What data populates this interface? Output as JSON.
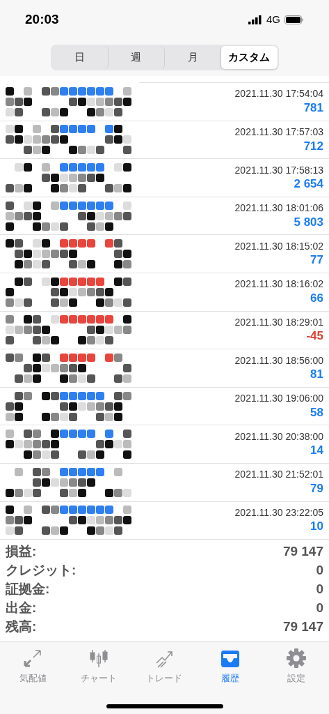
{
  "status_bar": {
    "time": "20:03",
    "network": "4G"
  },
  "segments": [
    {
      "label": "日",
      "selected": false
    },
    {
      "label": "週",
      "selected": false
    },
    {
      "label": "月",
      "selected": false
    },
    {
      "label": "カスタム",
      "selected": true
    }
  ],
  "trades": [
    {
      "time": "2021.11.30 17:54:04",
      "profit": "781",
      "loss": false,
      "color": "#2f7ff0"
    },
    {
      "time": "2021.11.30 17:57:03",
      "profit": "712",
      "loss": false,
      "color": "#2f7ff0"
    },
    {
      "time": "2021.11.30 17:58:13",
      "profit": "2 654",
      "loss": false,
      "color": "#2f7ff0"
    },
    {
      "time": "2021.11.30 18:01:06",
      "profit": "5 803",
      "loss": false,
      "color": "#2f7ff0"
    },
    {
      "time": "2021.11.30 18:15:02",
      "profit": "77",
      "loss": false,
      "color": "#e8453c"
    },
    {
      "time": "2021.11.30 18:16:02",
      "profit": "66",
      "loss": false,
      "color": "#e8453c"
    },
    {
      "time": "2021.11.30 18:29:01",
      "profit": "-45",
      "loss": true,
      "color": "#e8453c"
    },
    {
      "time": "2021.11.30 18:56:00",
      "profit": "81",
      "loss": false,
      "color": "#e8453c"
    },
    {
      "time": "2021.11.30 19:06:00",
      "profit": "58",
      "loss": false,
      "color": "#2f7ff0"
    },
    {
      "time": "2021.11.30 20:38:00",
      "profit": "14",
      "loss": false,
      "color": "#2f7ff0"
    },
    {
      "time": "2021.11.30 21:52:01",
      "profit": "79",
      "loss": false,
      "color": "#2f7ff0"
    },
    {
      "time": "2021.11.30 23:22:05",
      "profit": "10",
      "loss": false,
      "color": "#2f7ff0"
    }
  ],
  "summary": [
    {
      "label": "損益:",
      "value": "79 147"
    },
    {
      "label": "クレジット:",
      "value": "0"
    },
    {
      "label": "証拠金:",
      "value": "0"
    },
    {
      "label": "出金:",
      "value": "0"
    },
    {
      "label": "残高:",
      "value": "79 147"
    }
  ],
  "tab_bar": [
    {
      "label": "気配値",
      "kind": "quotes",
      "selected": false
    },
    {
      "label": "チャート",
      "kind": "chart",
      "selected": false
    },
    {
      "label": "トレード",
      "kind": "trade",
      "selected": false
    },
    {
      "label": "履歴",
      "kind": "history",
      "selected": true
    },
    {
      "label": "設定",
      "kind": "settings",
      "selected": false
    }
  ]
}
